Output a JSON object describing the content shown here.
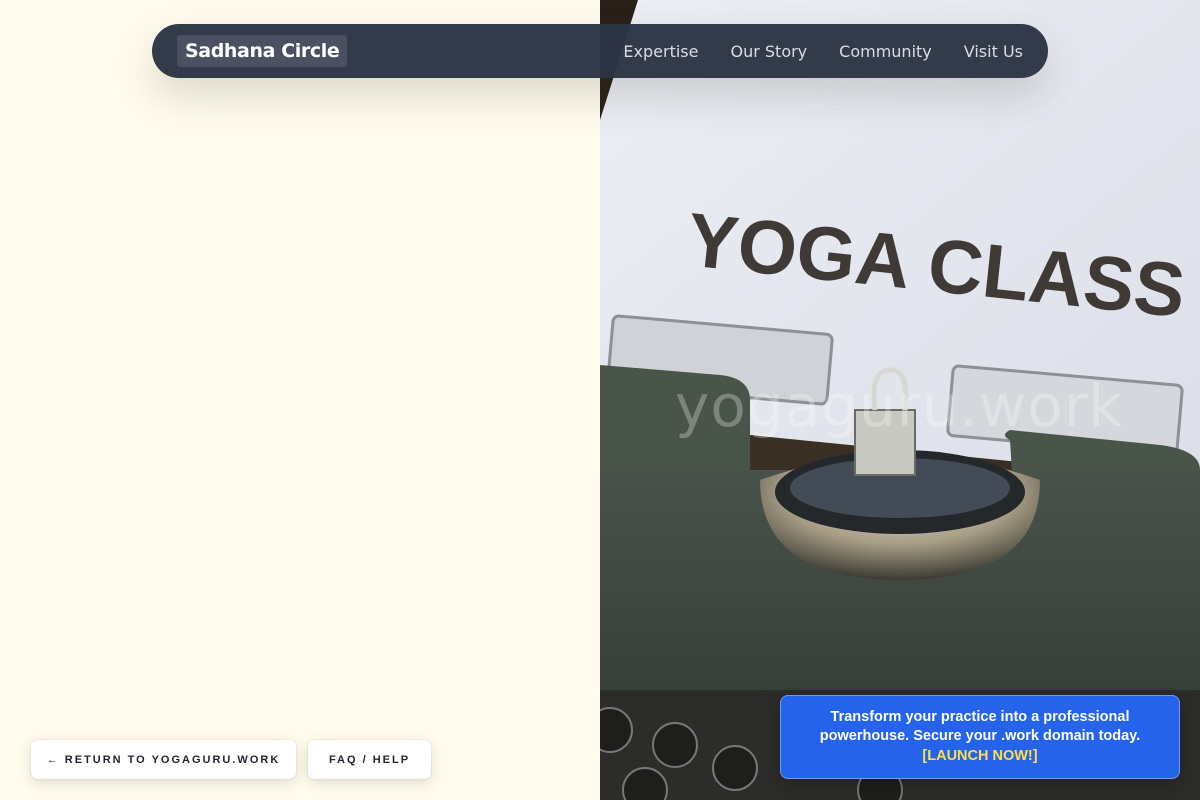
{
  "nav": {
    "brand": "Sadhana Circle",
    "links": [
      "Expertise",
      "Our Story",
      "Community",
      "Visit Us"
    ]
  },
  "hero_image": {
    "paper_text": "YOGA CLASS",
    "watermark": "yogaguru.work"
  },
  "footer_buttons": {
    "return_label": "← RETURN TO YOGAGURU.WORK",
    "faq_label": "FAQ / HELP"
  },
  "promo": {
    "text": "Transform your practice into a professional powerhouse. Secure your .work domain today.",
    "cta": "[LAUNCH NOW!]"
  },
  "colors": {
    "page_background": "#fffcee",
    "navbar": "#2c3444",
    "promo_background": "#2563eb",
    "promo_cta": "#fde047"
  }
}
